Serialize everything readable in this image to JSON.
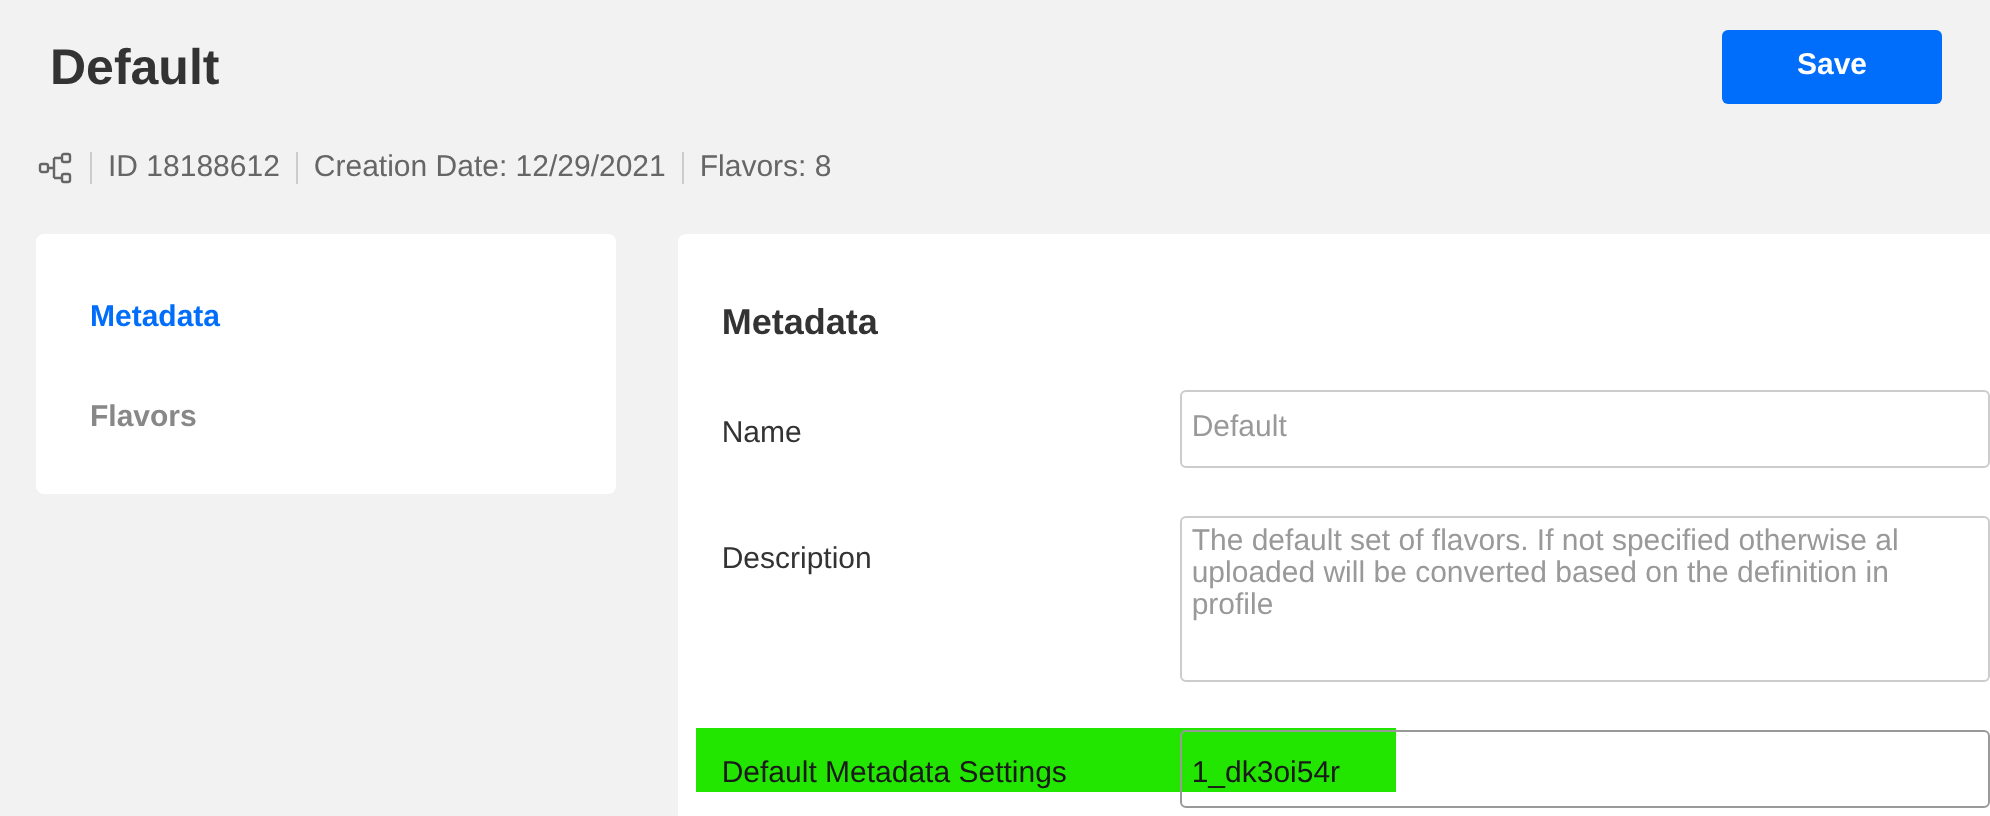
{
  "header": {
    "title": "Default",
    "save_label": "Save"
  },
  "meta": [
    "ID 18188612",
    "Creation Date: 12/29/2021",
    "Flavors: 8"
  ],
  "sidebar": {
    "items": [
      {
        "label": "Metadata",
        "selected": true
      },
      {
        "label": "Flavors",
        "selected": false
      }
    ]
  },
  "panel": {
    "heading": "Metadata",
    "fields": [
      {
        "kind": "input",
        "label": "Name",
        "value": "Default",
        "highlighted": false
      },
      {
        "kind": "textarea",
        "label": "Description",
        "lines": [
          "The default set of flavors. If not specified otherwise al",
          "uploaded will be converted based on the definition in",
          "profile"
        ],
        "highlighted": false
      },
      {
        "kind": "input",
        "label": "Default Metadata Settings",
        "value": "1_dk3oi54r",
        "highlighted": true
      }
    ]
  }
}
